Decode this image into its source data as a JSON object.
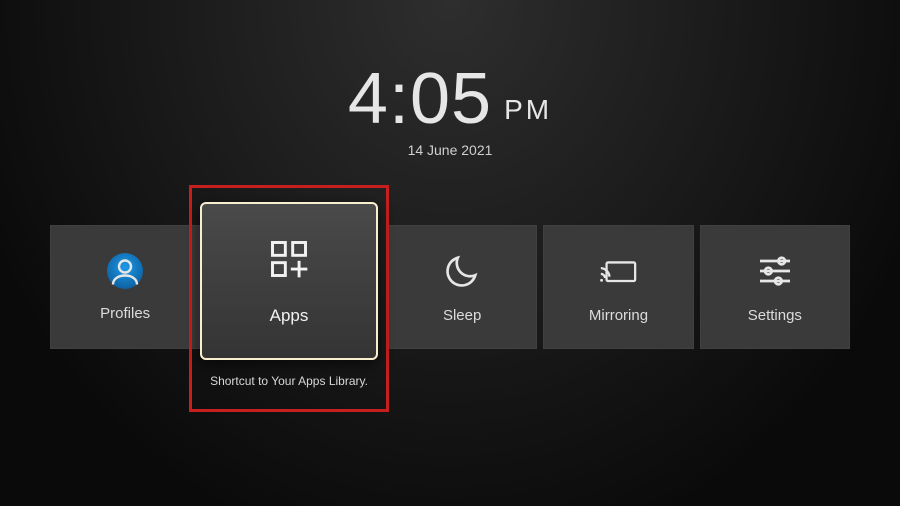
{
  "clock": {
    "time": "4:05",
    "ampm": "PM",
    "date": "14 June 2021"
  },
  "tiles": {
    "profiles": {
      "label": "Profiles"
    },
    "apps": {
      "label": "Apps",
      "caption": "Shortcut to Your Apps Library."
    },
    "sleep": {
      "label": "Sleep"
    },
    "mirroring": {
      "label": "Mirroring"
    },
    "settings": {
      "label": "Settings"
    }
  }
}
